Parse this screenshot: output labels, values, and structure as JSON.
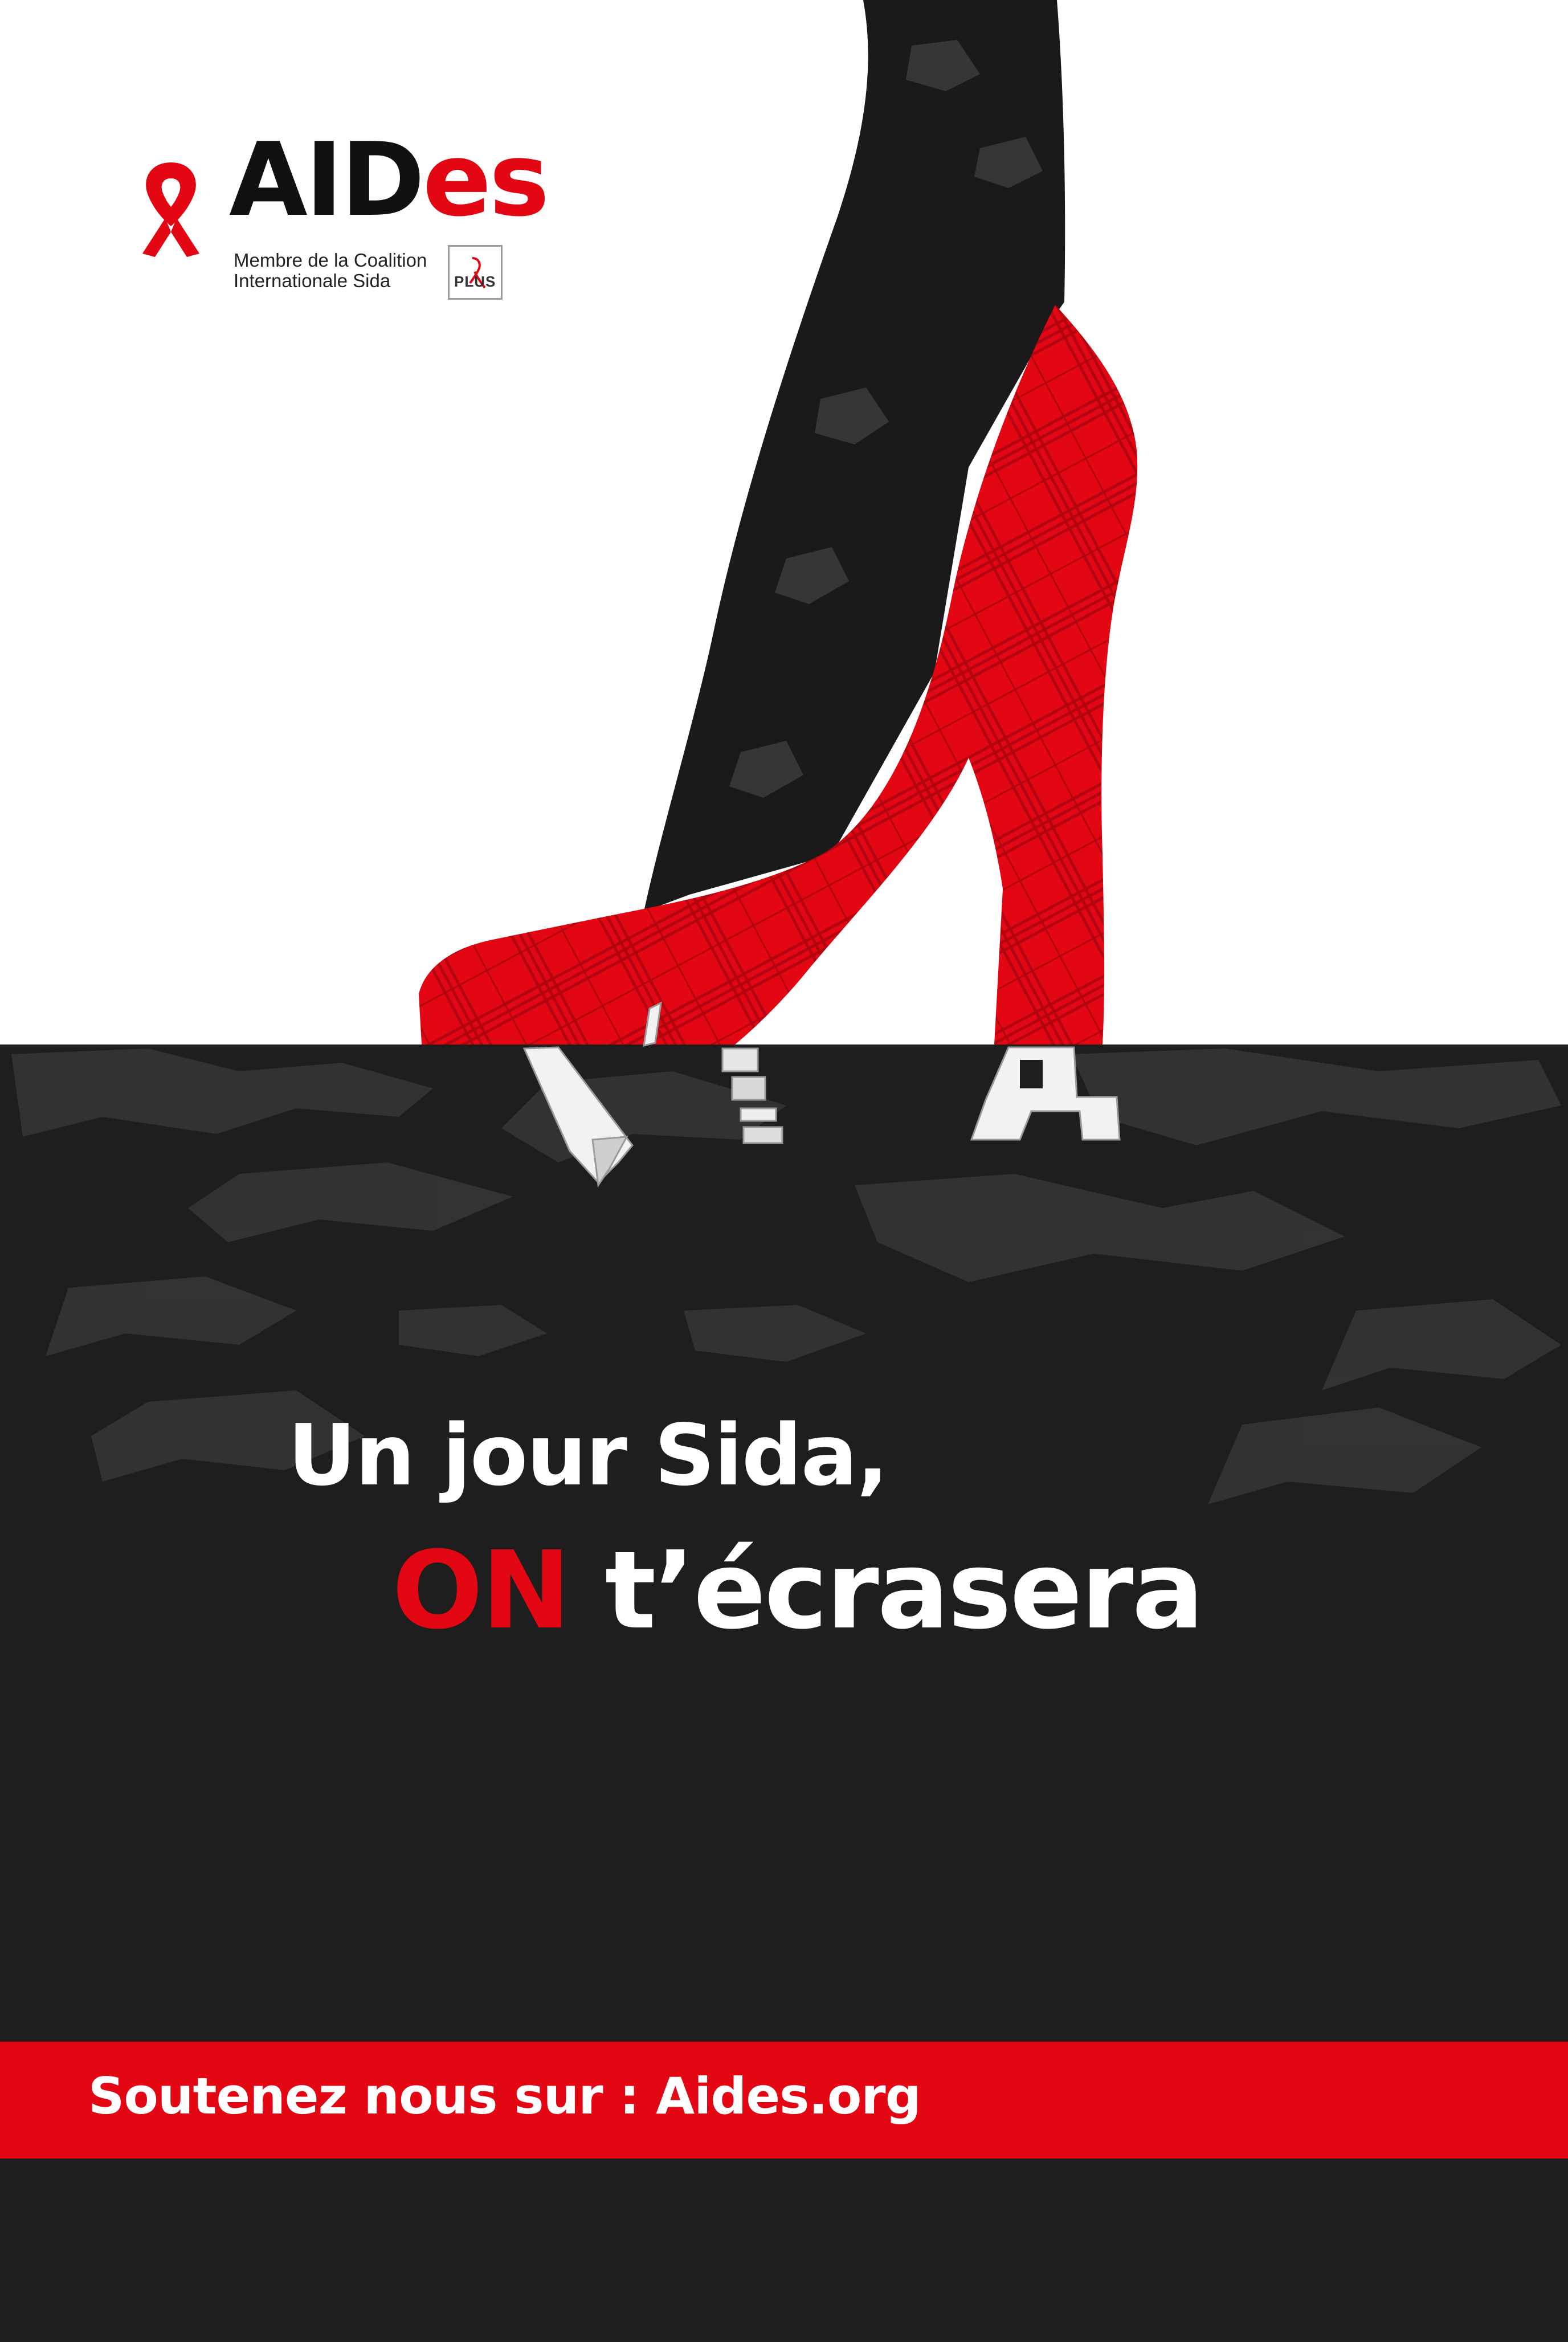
{
  "logo": {
    "word_part1": "AID",
    "word_part2": "es",
    "subtitle_line1": "Membre de la Coalition",
    "subtitle_line2": "Internationale Sida",
    "badge_text": "PLUS",
    "ribbon_icon": "red-ribbon-icon"
  },
  "headline": {
    "line1": "Un jour Sida,",
    "line2_highlight": "ON",
    "line2_rest": "t’écrasera"
  },
  "banner": {
    "text": "Soutenez nous sur : Aides.org"
  },
  "colors": {
    "brand_red": "#e30613",
    "dark_ground": "#1e1e1e",
    "leg": "#1a1a1a",
    "white": "#ffffff"
  }
}
